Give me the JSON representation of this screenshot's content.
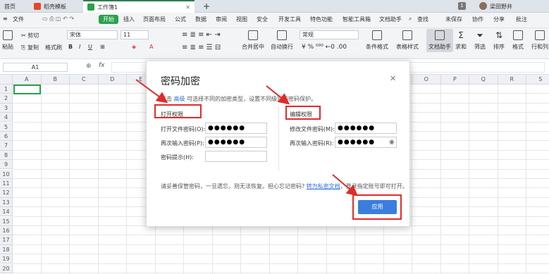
{
  "tabs": [
    {
      "label": "首页"
    },
    {
      "label": "稻壳模板"
    },
    {
      "label": "工作簿1"
    }
  ],
  "menu": {
    "file": "文件",
    "start": "开始",
    "items": [
      "插入",
      "页面布局",
      "公式",
      "数据",
      "审阅",
      "视图",
      "安全",
      "开发工具",
      "特色功能",
      "智能工具箱",
      "文档助手"
    ],
    "search": "查找",
    "unsaved": "未保存",
    "collab": "协作",
    "share": "分享",
    "user": "梁田野井",
    "annotate": "批注"
  },
  "ribbon": {
    "paste": "粘贴",
    "cut": "剪切",
    "copy": "复制",
    "format_painter": "格式刷",
    "font": "宋体",
    "size": "11",
    "number_format": "常规",
    "merge": "合并居中",
    "wrap": "自动换行",
    "cond_format": "条件格式",
    "table_style": "表格样式",
    "doc_helper": "文档助手",
    "sum": "求和",
    "filter": "筛选",
    "sort": "排序",
    "format": "格式",
    "row_col": "行和列"
  },
  "formula": {
    "cell_ref": "A1",
    "fx": "fx"
  },
  "grid": {
    "columns": [
      "A",
      "B",
      "C",
      "D",
      "E",
      "F",
      "G",
      "H",
      "I",
      "J",
      "K",
      "L",
      "M",
      "N",
      "O",
      "P",
      "Q",
      "R",
      "S"
    ],
    "rows": [
      "1",
      "2",
      "3",
      "4",
      "5",
      "6",
      "7",
      "8",
      "9",
      "10",
      "11",
      "12",
      "13",
      "14",
      "15",
      "16",
      "17",
      "18",
      "19",
      "20"
    ]
  },
  "dialog": {
    "title": "密码加密",
    "hint_prefix": "点击",
    "hint_link": "高级",
    "hint_suffix": "可选择不同的加密类型，设置不同级别的密码保护。",
    "open_section": "打开权限",
    "edit_section": "编辑权限",
    "open_pwd_label": "打开文件密码(O):",
    "open_pwd_value": "●●●●●●",
    "open_repeat_label": "再次输入密码(P):",
    "open_repeat_value": "●●●●●●",
    "pwd_hint_label": "密码提示(H):",
    "pwd_hint_value": "",
    "edit_pwd_label": "修改文件密码(M):",
    "edit_pwd_value": "●●●●●●",
    "edit_repeat_label": "再次输入密码(R):",
    "edit_repeat_value": "●●●●●●",
    "notice": "请妥善保管密码，一旦遗忘，则无法恢复。担心忘记密码?",
    "private_link": "转为私密文档",
    "notice_suffix": "，登录指定账号即可打开。",
    "apply": "应用"
  },
  "colors": {
    "accent": "#2aa24a",
    "button": "#3b7ddd",
    "link": "#2b6ed8",
    "annotation": "#e02b2b"
  }
}
